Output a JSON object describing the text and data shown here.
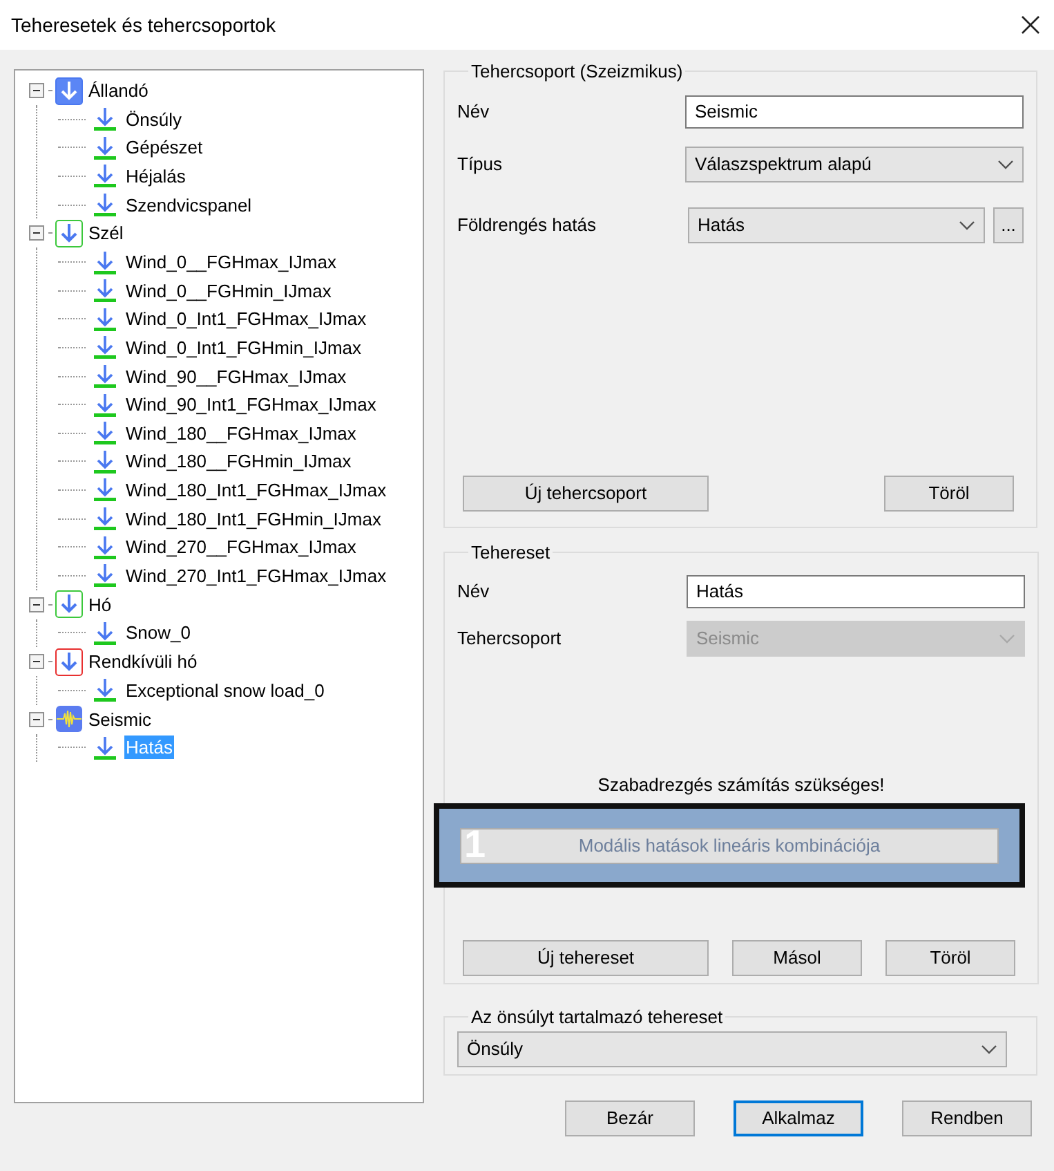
{
  "window": {
    "title": "Teheresetek és tehercsoportok"
  },
  "tree": [
    {
      "label": "Állandó",
      "kind": "solid",
      "expanded": true,
      "selected": false,
      "children": [
        {
          "label": "Önsúly",
          "selected": false
        },
        {
          "label": "Gépészet",
          "selected": false
        },
        {
          "label": "Héjalás",
          "selected": false
        },
        {
          "label": "Szendvicspanel",
          "selected": false
        }
      ]
    },
    {
      "label": "Szél",
      "kind": "green",
      "expanded": true,
      "selected": false,
      "children": [
        {
          "label": "Wind_0__FGHmax_IJmax",
          "selected": false
        },
        {
          "label": "Wind_0__FGHmin_IJmax",
          "selected": false
        },
        {
          "label": "Wind_0_Int1_FGHmax_IJmax",
          "selected": false
        },
        {
          "label": "Wind_0_Int1_FGHmin_IJmax",
          "selected": false
        },
        {
          "label": "Wind_90__FGHmax_IJmax",
          "selected": false
        },
        {
          "label": "Wind_90_Int1_FGHmax_IJmax",
          "selected": false
        },
        {
          "label": "Wind_180__FGHmax_IJmax",
          "selected": false
        },
        {
          "label": "Wind_180__FGHmin_IJmax",
          "selected": false
        },
        {
          "label": "Wind_180_Int1_FGHmax_IJmax",
          "selected": false
        },
        {
          "label": "Wind_180_Int1_FGHmin_IJmax",
          "selected": false
        },
        {
          "label": "Wind_270__FGHmax_IJmax",
          "selected": false
        },
        {
          "label": "Wind_270_Int1_FGHmax_IJmax",
          "selected": false
        }
      ]
    },
    {
      "label": "Hó",
      "kind": "green",
      "expanded": true,
      "selected": false,
      "children": [
        {
          "label": "Snow_0",
          "selected": false
        }
      ]
    },
    {
      "label": "Rendkívüli hó",
      "kind": "red",
      "expanded": true,
      "selected": false,
      "children": [
        {
          "label": "Exceptional snow load_0",
          "selected": false
        }
      ]
    },
    {
      "label": "Seismic",
      "kind": "seismic",
      "expanded": true,
      "selected": false,
      "children": [
        {
          "label": "Hatás",
          "selected": true
        }
      ]
    }
  ],
  "group": {
    "legend": "Tehercsoport (Szeizmikus)",
    "name_label": "Név",
    "name_value": "Seismic",
    "type_label": "Típus",
    "type_value": "Válaszspektrum alapú",
    "effect_label": "Földrengés hatás",
    "effect_value": "Hatás",
    "more_button": "...",
    "new_button": "Új tehercsoport",
    "delete_button": "Töröl"
  },
  "case": {
    "legend": "Tehereset",
    "name_label": "Név",
    "name_value": "Hatás",
    "group_label": "Tehercsoport",
    "group_value": "Seismic",
    "group_disabled": true,
    "message": "Szabadrezgés számítás szükséges!",
    "combo_button": "Modális hatások lineáris kombinációja",
    "combo_disabled": true,
    "callout": "1",
    "new_button": "Új tehereset",
    "copy_button": "Másol",
    "delete_button": "Töröl"
  },
  "selfweight": {
    "legend": "Az önsúlyt tartalmazó tehereset",
    "value": "Önsúly"
  },
  "buttons": [
    {
      "label": "Bezár",
      "default": false
    },
    {
      "label": "Alkalmaz",
      "default": true
    },
    {
      "label": "Rendben",
      "default": false
    }
  ]
}
